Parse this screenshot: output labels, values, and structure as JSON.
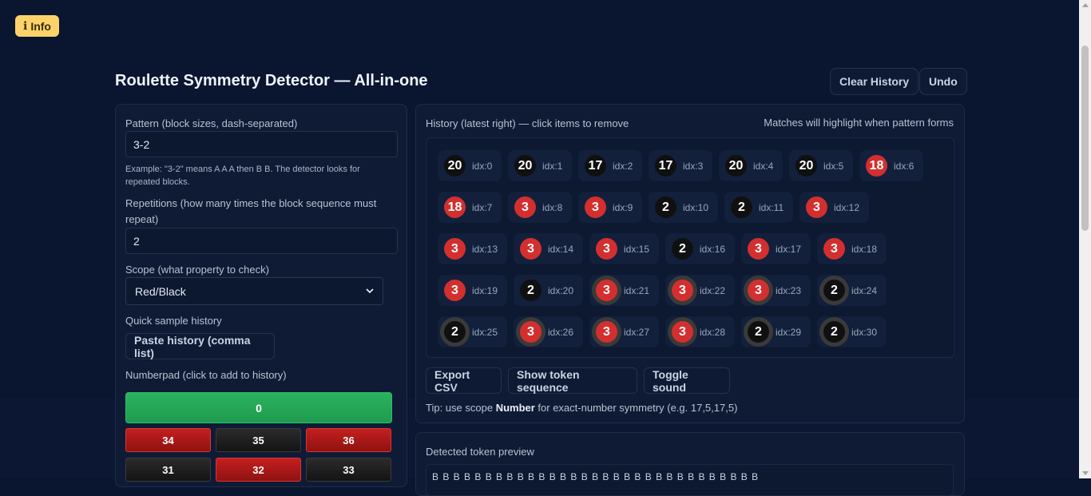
{
  "info_button": {
    "icon": "ℹ",
    "label": "Info"
  },
  "header": {
    "title": "Roulette Symmetry Detector — All-in-one",
    "clear_label": "Clear History",
    "undo_label": "Undo"
  },
  "left": {
    "pattern_label": "Pattern (block sizes, dash-separated)",
    "pattern_value": "3-2",
    "pattern_note": "Example: \"3-2\" means A A A then B B. The detector looks for repeated blocks.",
    "reps_label": "Repetitions (how many times the block sequence must repeat)",
    "reps_value": "2",
    "scope_label": "Scope (what property to check)",
    "scope_value": "Red/Black",
    "quick_label": "Quick sample history",
    "paste_label": "Paste history (comma list)",
    "numpad_label": "Numberpad (click to add to history)",
    "zero": "0",
    "keys": [
      {
        "n": "34",
        "c": "red"
      },
      {
        "n": "35",
        "c": "black"
      },
      {
        "n": "36",
        "c": "red"
      },
      {
        "n": "31",
        "c": "black"
      },
      {
        "n": "32",
        "c": "red"
      },
      {
        "n": "33",
        "c": "black"
      }
    ]
  },
  "history": {
    "title": "History (latest right) — click items to remove",
    "hint": "Matches will highlight when pattern forms",
    "items": [
      {
        "n": "20",
        "c": "black",
        "idx": "idx:0",
        "hl": false
      },
      {
        "n": "20",
        "c": "black",
        "idx": "idx:1",
        "hl": false
      },
      {
        "n": "17",
        "c": "black",
        "idx": "idx:2",
        "hl": false
      },
      {
        "n": "17",
        "c": "black",
        "idx": "idx:3",
        "hl": false
      },
      {
        "n": "20",
        "c": "black",
        "idx": "idx:4",
        "hl": false
      },
      {
        "n": "20",
        "c": "black",
        "idx": "idx:5",
        "hl": false
      },
      {
        "n": "18",
        "c": "red",
        "idx": "idx:6",
        "hl": false
      },
      {
        "n": "18",
        "c": "red",
        "idx": "idx:7",
        "hl": false
      },
      {
        "n": "3",
        "c": "red",
        "idx": "idx:8",
        "hl": false
      },
      {
        "n": "3",
        "c": "red",
        "idx": "idx:9",
        "hl": false
      },
      {
        "n": "2",
        "c": "black",
        "idx": "idx:10",
        "hl": false
      },
      {
        "n": "2",
        "c": "black",
        "idx": "idx:11",
        "hl": false
      },
      {
        "n": "3",
        "c": "red",
        "idx": "idx:12",
        "hl": false
      },
      {
        "n": "3",
        "c": "red",
        "idx": "idx:13",
        "hl": false
      },
      {
        "n": "3",
        "c": "red",
        "idx": "idx:14",
        "hl": false
      },
      {
        "n": "3",
        "c": "red",
        "idx": "idx:15",
        "hl": false
      },
      {
        "n": "2",
        "c": "black",
        "idx": "idx:16",
        "hl": false
      },
      {
        "n": "3",
        "c": "red",
        "idx": "idx:17",
        "hl": false
      },
      {
        "n": "3",
        "c": "red",
        "idx": "idx:18",
        "hl": false
      },
      {
        "n": "3",
        "c": "red",
        "idx": "idx:19",
        "hl": false
      },
      {
        "n": "2",
        "c": "black",
        "idx": "idx:20",
        "hl": false
      },
      {
        "n": "3",
        "c": "red",
        "idx": "idx:21",
        "hl": true
      },
      {
        "n": "3",
        "c": "red",
        "idx": "idx:22",
        "hl": true
      },
      {
        "n": "3",
        "c": "red",
        "idx": "idx:23",
        "hl": true
      },
      {
        "n": "2",
        "c": "black",
        "idx": "idx:24",
        "hl": true
      },
      {
        "n": "2",
        "c": "black",
        "idx": "idx:25",
        "hl": true
      },
      {
        "n": "3",
        "c": "red",
        "idx": "idx:26",
        "hl": true
      },
      {
        "n": "3",
        "c": "red",
        "idx": "idx:27",
        "hl": true
      },
      {
        "n": "3",
        "c": "red",
        "idx": "idx:28",
        "hl": true
      },
      {
        "n": "2",
        "c": "black",
        "idx": "idx:29",
        "hl": true
      },
      {
        "n": "2",
        "c": "black",
        "idx": "idx:30",
        "hl": true
      }
    ],
    "export_label": "Export CSV",
    "show_tokens_label": "Show token sequence",
    "toggle_sound_label": "Toggle sound",
    "tip_prefix": "Tip: use scope ",
    "tip_bold": "Number",
    "tip_suffix": " for exact-number symmetry (e.g. 17,5,17,5)"
  },
  "preview": {
    "title": "Detected token preview",
    "tokens": "B B B B B B B B B B B B B B B B B B B B B B B B B B B B B B B"
  }
}
